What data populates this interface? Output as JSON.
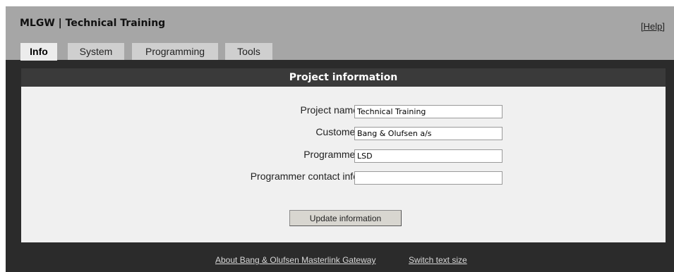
{
  "header": {
    "title": "MLGW | Technical Training",
    "help_label": "[Help]"
  },
  "tabs": [
    {
      "label": "Info",
      "active": true
    },
    {
      "label": "System",
      "active": false
    },
    {
      "label": "Programming",
      "active": false
    },
    {
      "label": "Tools",
      "active": false
    }
  ],
  "panel": {
    "title": "Project information",
    "fields": [
      {
        "label": "Project name",
        "value": "Technical Training"
      },
      {
        "label": "Customer",
        "value": "Bang & Olufsen a/s"
      },
      {
        "label": "Programmer",
        "value": "LSD"
      },
      {
        "label": "Programmer contact info",
        "value": ""
      }
    ],
    "update_label": "Update information"
  },
  "footer": {
    "about_label": "About Bang & Olufsen Masterlink Gateway",
    "switch_label": "Switch text size"
  },
  "colors": {
    "header_bg": "#a6a6a6",
    "frame_bg": "#2b2b2b",
    "panel_bg": "#f0f0f0",
    "active_tab": "#ececec"
  }
}
